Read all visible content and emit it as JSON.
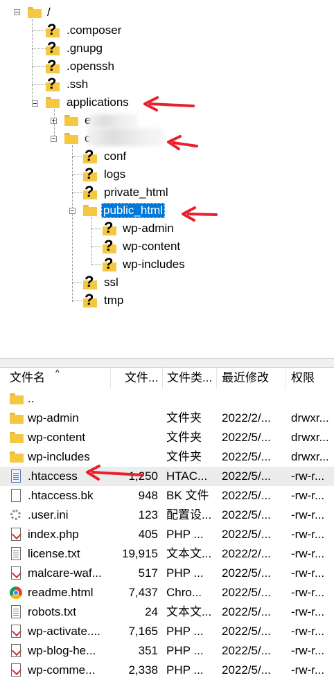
{
  "tree": {
    "root": "/",
    "nodes": [
      {
        "label": ".composer"
      },
      {
        "label": ".gnupg"
      },
      {
        "label": ".openssh"
      },
      {
        "label": ".ssh"
      },
      {
        "label": "applications"
      },
      {
        "label": "e"
      },
      {
        "label": "c"
      },
      {
        "label": "conf"
      },
      {
        "label": "logs"
      },
      {
        "label": "private_html"
      },
      {
        "label": "public_html"
      },
      {
        "label": "wp-admin"
      },
      {
        "label": "wp-content"
      },
      {
        "label": "wp-includes"
      },
      {
        "label": "ssl"
      },
      {
        "label": "tmp"
      }
    ]
  },
  "list": {
    "headers": [
      "文件名",
      "文件...",
      "文件类...",
      "最近修改",
      "权限"
    ],
    "rows": [
      {
        "name": "..",
        "size": "",
        "type": "",
        "modified": "",
        "perm": "",
        "icon": "folder-icon"
      },
      {
        "name": "wp-admin",
        "size": "",
        "type": "文件夹",
        "modified": "2022/2/...",
        "perm": "drwxr...",
        "icon": "folder-icon"
      },
      {
        "name": "wp-content",
        "size": "",
        "type": "文件夹",
        "modified": "2022/5/...",
        "perm": "drwxr...",
        "icon": "folder-icon"
      },
      {
        "name": "wp-includes",
        "size": "",
        "type": "文件夹",
        "modified": "2022/5/...",
        "perm": "drwxr...",
        "icon": "folder-icon"
      },
      {
        "name": ".htaccess",
        "size": "1,250",
        "type": "HTAC...",
        "modified": "2022/5/...",
        "perm": "-rw-r...",
        "icon": "htaccess-file-icon"
      },
      {
        "name": ".htaccess.bk",
        "size": "948",
        "type": "BK 文件",
        "modified": "2022/5/...",
        "perm": "-rw-r...",
        "icon": "blank-file-icon"
      },
      {
        "name": ".user.ini",
        "size": "123",
        "type": "配置设...",
        "modified": "2022/5/...",
        "perm": "-rw-r...",
        "icon": "settings-file-icon"
      },
      {
        "name": "index.php",
        "size": "405",
        "type": "PHP ...",
        "modified": "2022/5/...",
        "perm": "-rw-r...",
        "icon": "php-file-icon"
      },
      {
        "name": "license.txt",
        "size": "19,915",
        "type": "文本文...",
        "modified": "2022/2/...",
        "perm": "-rw-r...",
        "icon": "text-file-icon"
      },
      {
        "name": "malcare-waf...",
        "size": "517",
        "type": "PHP ...",
        "modified": "2022/5/...",
        "perm": "-rw-r...",
        "icon": "php-file-icon"
      },
      {
        "name": "readme.html",
        "size": "7,437",
        "type": "Chro...",
        "modified": "2022/5/...",
        "perm": "-rw-r...",
        "icon": "chrome-file-icon"
      },
      {
        "name": "robots.txt",
        "size": "24",
        "type": "文本文...",
        "modified": "2022/5/...",
        "perm": "-rw-r...",
        "icon": "text-file-icon"
      },
      {
        "name": "wp-activate....",
        "size": "7,165",
        "type": "PHP ...",
        "modified": "2022/5/...",
        "perm": "-rw-r...",
        "icon": "php-file-icon"
      },
      {
        "name": "wp-blog-he...",
        "size": "351",
        "type": "PHP ...",
        "modified": "2022/5/...",
        "perm": "-rw-r...",
        "icon": "php-file-icon"
      },
      {
        "name": "wp-comme...",
        "size": "2,338",
        "type": "PHP ...",
        "modified": "2022/5/...",
        "perm": "-rw-r...",
        "icon": "php-file-icon"
      }
    ]
  },
  "colors": {
    "arrow": "#e8202a",
    "selection": "#0078d7",
    "folder": "#f5c842"
  }
}
